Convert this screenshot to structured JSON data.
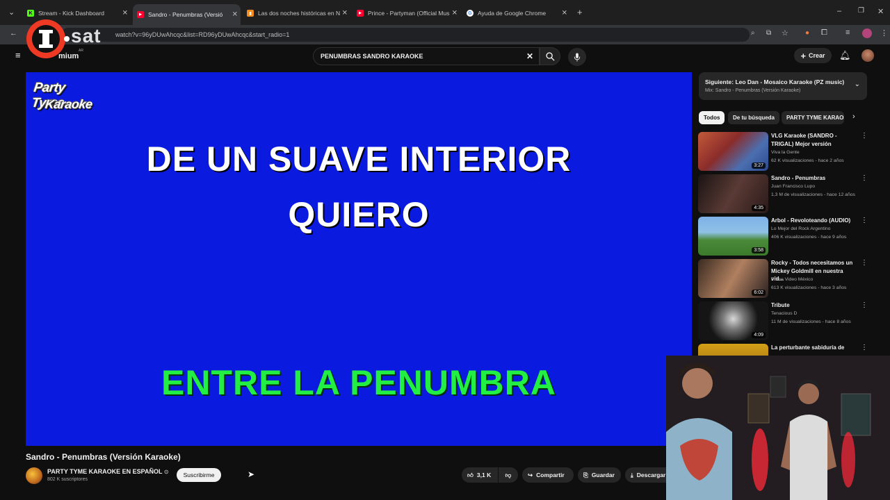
{
  "browser": {
    "tabs": [
      {
        "title": "Stream - Kick Dashboard",
        "favicon": "K",
        "color": "#53fc18"
      },
      {
        "title": "Sandro - Penumbras (Versió",
        "favicon": "▶",
        "color": "#ff0033"
      },
      {
        "title": "Las dos noches históricas en N",
        "favicon": "▮",
        "color": "#f28c1a"
      },
      {
        "title": "Prince - Partyman (Official Mus",
        "favicon": "▶",
        "color": "#ff0033"
      },
      {
        "title": "Ayuda de Google Chrome",
        "favicon": "G",
        "color": "#4285f4"
      }
    ],
    "url": "watch?v=96yDUwAhcqc&list=RD96yDUwAhcqc&start_radio=1"
  },
  "watermark": {
    "brand": "I",
    "text": "sat"
  },
  "youtube": {
    "logo_partial": "mium",
    "logo_region": "AR",
    "search_value": "PENUMBRAS SANDRO KARAOKE",
    "create_label": "Crear"
  },
  "player": {
    "logo_line1": "Party Tyme",
    "logo_line2": "Karaoke",
    "lyric_line1": "DE UN SUAVE INTERIOR",
    "lyric_line2": "QUIERO",
    "lyric_line3": "ENTRE LA PENUMBRA",
    "bg_color": "#0b1adf",
    "highlight_color": "#22ee44"
  },
  "video": {
    "title": "Sandro - Penumbras (Versión Karaoke)",
    "channel": "PARTY TYME KARAOKE EN ESPAÑOL",
    "subscribers": "802 K suscriptores",
    "subscribe_label": "Suscribirme",
    "likes": "3,1 K",
    "share_label": "Compartir",
    "save_label": "Guardar",
    "download_label": "Descargar"
  },
  "sidebar": {
    "up_next_title": "Siguiente: Leo Dan - Mosaico Karaoke (PZ music)",
    "up_next_sub": "Mix: Sandro - Penumbras (Versión Karaoke)",
    "chips": [
      "Todos",
      "De tu búsqueda",
      "PARTY TYME KARAOK"
    ],
    "recommendations": [
      {
        "title": "VLG Karaoke  (SANDRO - TRIGAL) Mejor versión",
        "channel": "Viva la Gente",
        "meta": "62 K visualizaciones - hace 2 años",
        "duration": "3:27"
      },
      {
        "title": "Sandro - Penumbras",
        "channel": "Juan Francisco Lupo",
        "meta": "1,3 M de visualizaciones - hace 12 años",
        "duration": "4:35"
      },
      {
        "title": "Arbol - Revoloteando (AUDIO)",
        "channel": "Lo Mejor del Rock Argentino",
        "meta": "406 K visualizaciones - hace 9 años",
        "duration": "3:58"
      },
      {
        "title": "Rocky - Todos necesitamos un Mickey Goldmill en nuestra vid...",
        "channel": "Prime Video México",
        "meta": "613 K visualizaciones - hace 3 años",
        "duration": "6:02"
      },
      {
        "title": "Tribute",
        "channel": "Tenacious D",
        "meta": "11 M de visualizaciones - hace 8 años",
        "duration": "4:09"
      },
      {
        "title": "La perturbante sabiduría de",
        "channel": "",
        "meta": "",
        "duration": ""
      }
    ]
  }
}
